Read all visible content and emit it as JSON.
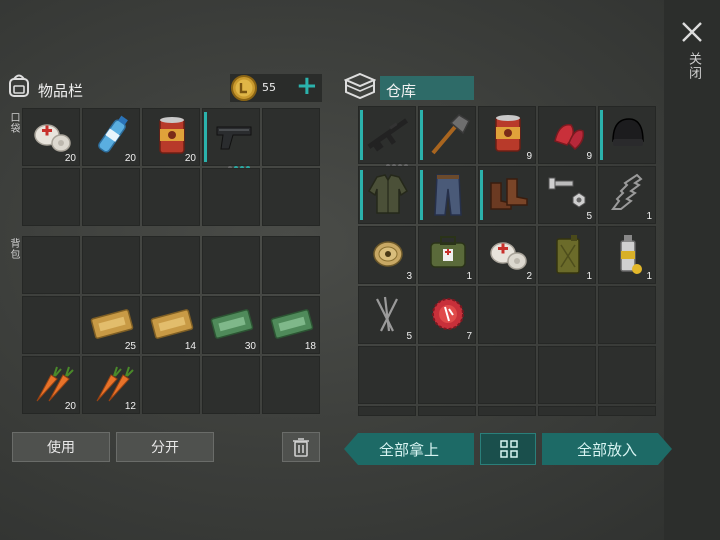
{
  "inventory": {
    "title": "物品栏",
    "coins": "55",
    "add": "+",
    "pocket_label": "口袋",
    "backpack_label": "背包",
    "pocket_slots": [
      {
        "icon": "bandage-icon",
        "count": "20"
      },
      {
        "icon": "water-bottle-icon",
        "count": "20"
      },
      {
        "icon": "canned-food-icon",
        "count": "20"
      },
      {
        "icon": "pistol-icon",
        "count": ""
      },
      {
        "icon": "",
        "count": ""
      }
    ],
    "backpack_slots": [
      {
        "icon": "",
        "count": ""
      },
      {
        "icon": "coupon-gold-icon",
        "count": "25"
      },
      {
        "icon": "coupon-gold-icon",
        "count": "14"
      },
      {
        "icon": "coupon-green-icon",
        "count": "30"
      },
      {
        "icon": "coupon-green-icon",
        "count": "18"
      },
      {
        "icon": "carrot-icon",
        "count": "20"
      },
      {
        "icon": "carrot-icon",
        "count": "12"
      }
    ]
  },
  "storage": {
    "title": "仓库",
    "slots": [
      {
        "icon": "rifle-icon",
        "count": ""
      },
      {
        "icon": "shovel-icon",
        "count": ""
      },
      {
        "icon": "canned-food-icon",
        "count": "9"
      },
      {
        "icon": "raw-meat-icon",
        "count": "9"
      },
      {
        "icon": "beanie-icon",
        "count": ""
      },
      {
        "icon": "jacket-icon",
        "count": ""
      },
      {
        "icon": "pants-icon",
        "count": ""
      },
      {
        "icon": "boots-icon",
        "count": ""
      },
      {
        "icon": "bolts-icon",
        "count": "5"
      },
      {
        "icon": "spring-icon",
        "count": "1"
      },
      {
        "icon": "wire-spool-icon",
        "count": "3"
      },
      {
        "icon": "medkit-icon",
        "count": "1"
      },
      {
        "icon": "bandage-icon",
        "count": "2"
      },
      {
        "icon": "fuel-can-icon",
        "count": "1"
      },
      {
        "icon": "spray-can-icon",
        "count": "1"
      },
      {
        "icon": "nails-icon",
        "count": "5"
      },
      {
        "icon": "bottle-cap-icon",
        "count": "7"
      }
    ]
  },
  "buttons": {
    "use": "使用",
    "split": "分开",
    "take_all": "全部拿上",
    "put_all": "全部放入"
  },
  "close_label": "关闭",
  "colors": {
    "accent": "#2bb2ac",
    "button_teal": "#1d6a66"
  }
}
